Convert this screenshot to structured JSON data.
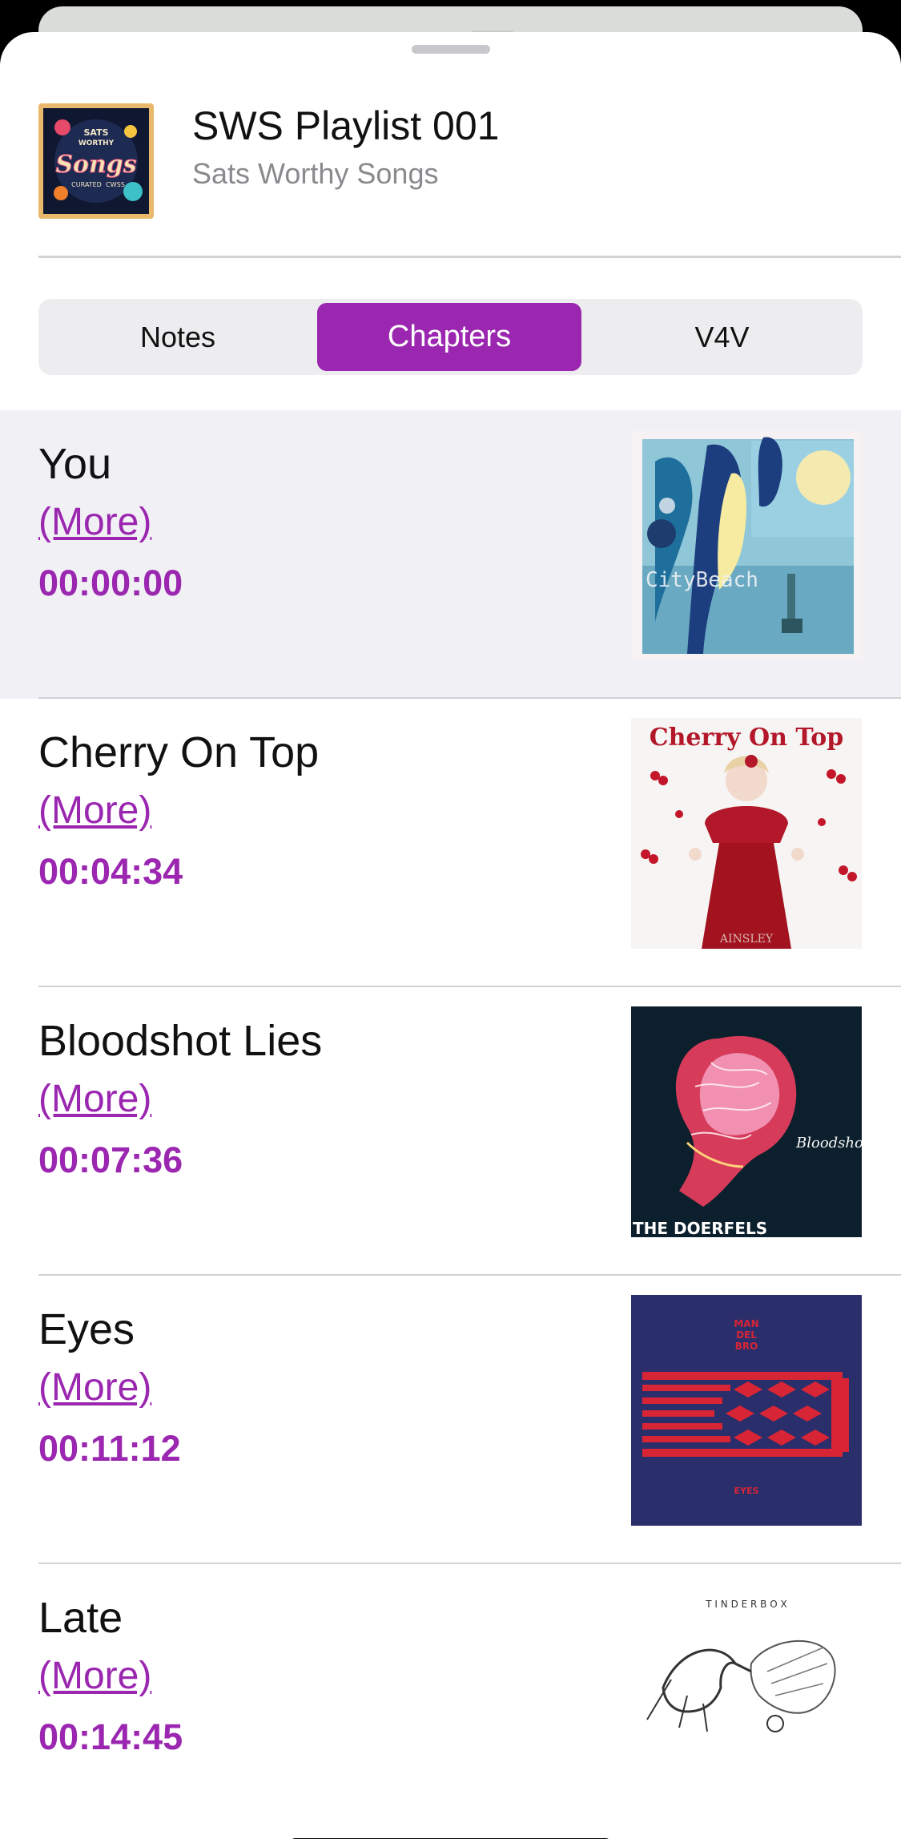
{
  "header": {
    "title": "SWS Playlist 001",
    "subtitle": "Sats Worthy Songs",
    "art_icon": "playlist-cover-art",
    "art_text": [
      "SATS",
      "WORTHY",
      "Songs",
      "CURATED",
      "CWSS"
    ]
  },
  "tabs": [
    {
      "label": "Notes",
      "selected": false
    },
    {
      "label": "Chapters",
      "selected": true
    },
    {
      "label": "V4V",
      "selected": false
    }
  ],
  "colors": {
    "accent": "#9b27b0",
    "active_row": "#f0f0f5",
    "divider": "#d1d1d6"
  },
  "chapters": [
    {
      "title": "You",
      "more": "(More)",
      "time": "00:00:00",
      "active": true,
      "art_icon": "city-beach-cover-art",
      "art_text": "CityBeach"
    },
    {
      "title": "Cherry On Top",
      "more": "(More)",
      "time": "00:04:34",
      "active": false,
      "art_icon": "cherry-on-top-cover-art",
      "art_text": "Cherry On Top",
      "art_caption": "AINSLEY"
    },
    {
      "title": "Bloodshot Lies",
      "more": "(More)",
      "time": "00:07:36",
      "active": false,
      "art_icon": "bloodshot-lies-cover-art",
      "art_text": "THE DOERFELS",
      "art_script": "Bloodshot Lies"
    },
    {
      "title": "Eyes",
      "more": "(More)",
      "time": "00:11:12",
      "active": false,
      "art_icon": "eyes-cover-art",
      "art_text": "EYES",
      "art_brand": [
        "MAN",
        "DEL",
        "BRO"
      ]
    },
    {
      "title": "Late",
      "more": "(More)",
      "time": "00:14:45",
      "active": false,
      "art_icon": "late-cover-art",
      "art_text": "T I N D E R B O X"
    }
  ]
}
